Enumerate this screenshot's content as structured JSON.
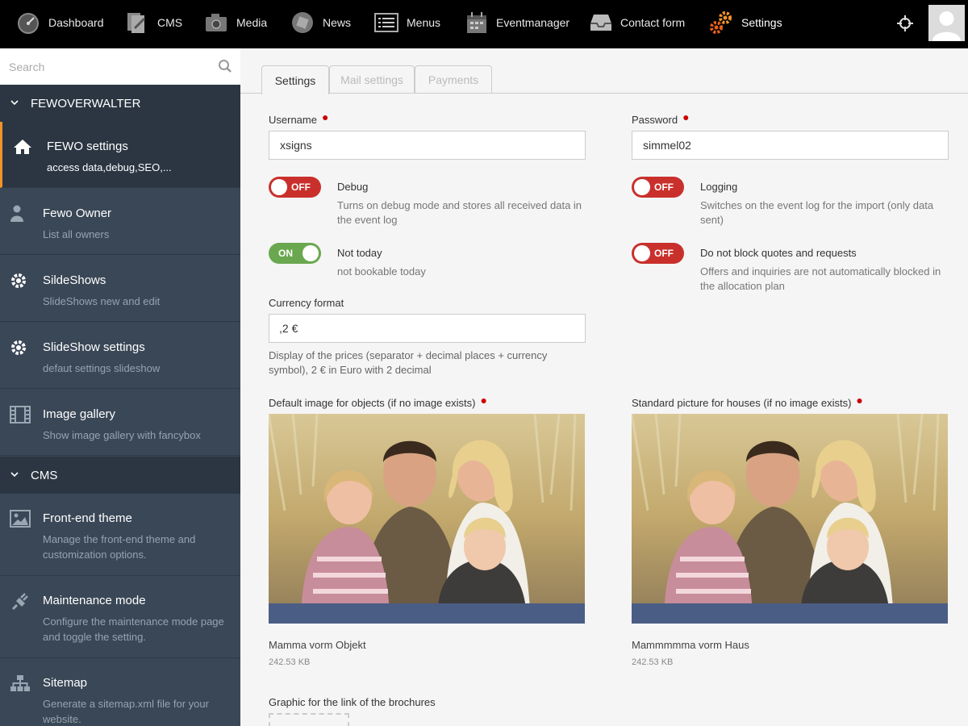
{
  "topnav": {
    "items": [
      {
        "label": "Dashboard",
        "icon": "gauge-icon"
      },
      {
        "label": "CMS",
        "icon": "cms-pages-icon"
      },
      {
        "label": "Media",
        "icon": "camera-icon"
      },
      {
        "label": "News",
        "icon": "news-icon"
      },
      {
        "label": "Menus",
        "icon": "menu-list-icon"
      },
      {
        "label": "Eventmanager",
        "icon": "calendar-icon"
      },
      {
        "label": "Contact form",
        "icon": "inbox-icon"
      },
      {
        "label": "Settings",
        "icon": "gears-icon"
      }
    ],
    "active": "Settings",
    "accent_color": "#f0932b"
  },
  "sidebar": {
    "search_placeholder": "Search",
    "sections": [
      {
        "title": "FEWOVERWALTER",
        "items": [
          {
            "title": "FEWO settings",
            "subtitle": "access data,debug,SEO,...",
            "icon": "home-icon",
            "active": true
          },
          {
            "title": "Fewo Owner",
            "subtitle": "List all owners",
            "icon": "user-icon"
          },
          {
            "title": "SildeShows",
            "subtitle": "SlideShows new and edit",
            "icon": "gear-icon"
          },
          {
            "title": "SlideShow settings",
            "subtitle": "defaut settings slideshow",
            "icon": "gear-icon"
          },
          {
            "title": "Image gallery",
            "subtitle": "Show image gallery with fancybox",
            "icon": "film-icon"
          }
        ]
      },
      {
        "title": "CMS",
        "items": [
          {
            "title": "Front-end theme",
            "subtitle": "Manage the front-end theme and customization options.",
            "icon": "image-icon"
          },
          {
            "title": "Maintenance mode",
            "subtitle": "Configure the maintenance mode page and toggle the setting.",
            "icon": "plug-icon"
          },
          {
            "title": "Sitemap",
            "subtitle": "Generate a sitemap.xml file for your website.",
            "icon": "sitemap-icon"
          }
        ]
      }
    ]
  },
  "tabs": [
    {
      "label": "Settings",
      "active": true
    },
    {
      "label": "Mail settings"
    },
    {
      "label": "Payments"
    }
  ],
  "form": {
    "username": {
      "label": "Username",
      "value": "xsigns",
      "required": true
    },
    "password": {
      "label": "Password",
      "value": "simmel02",
      "required": true
    },
    "debug": {
      "state": "OFF",
      "title": "Debug",
      "description": "Turns on debug mode and stores all received data in the event log"
    },
    "logging": {
      "state": "OFF",
      "title": "Logging",
      "description": "Switches on the event log for the import (only data sent)"
    },
    "not_today": {
      "state": "ON",
      "title": "Not today",
      "description": "not bookable today"
    },
    "no_block": {
      "state": "OFF",
      "title": "Do not block quotes and requests",
      "description": "Offers and inquiries are not automatically blocked in the allocation plan"
    },
    "currency": {
      "label": "Currency format",
      "value": ",2 €",
      "help": "Display of the prices (separator + decimal places + currency symbol), 2 € in Euro with 2 decimal"
    },
    "default_image": {
      "label": "Default image for objects (if no image exists)",
      "required": true,
      "file_name": "Mamma vorm Objekt",
      "file_size": "242.53 KB"
    },
    "house_image": {
      "label": "Standard picture for houses (if no image exists)",
      "required": true,
      "file_name": "Mammmmma vorm Haus",
      "file_size": "242.53 KB"
    },
    "brochure_graphic": {
      "label": "Graphic for the link of the brochures"
    }
  },
  "colors": {
    "toggle_off": "#c9302c",
    "toggle_on": "#6aa84f",
    "sidebar_bg": "#3a4756",
    "required": "#cc0000"
  }
}
